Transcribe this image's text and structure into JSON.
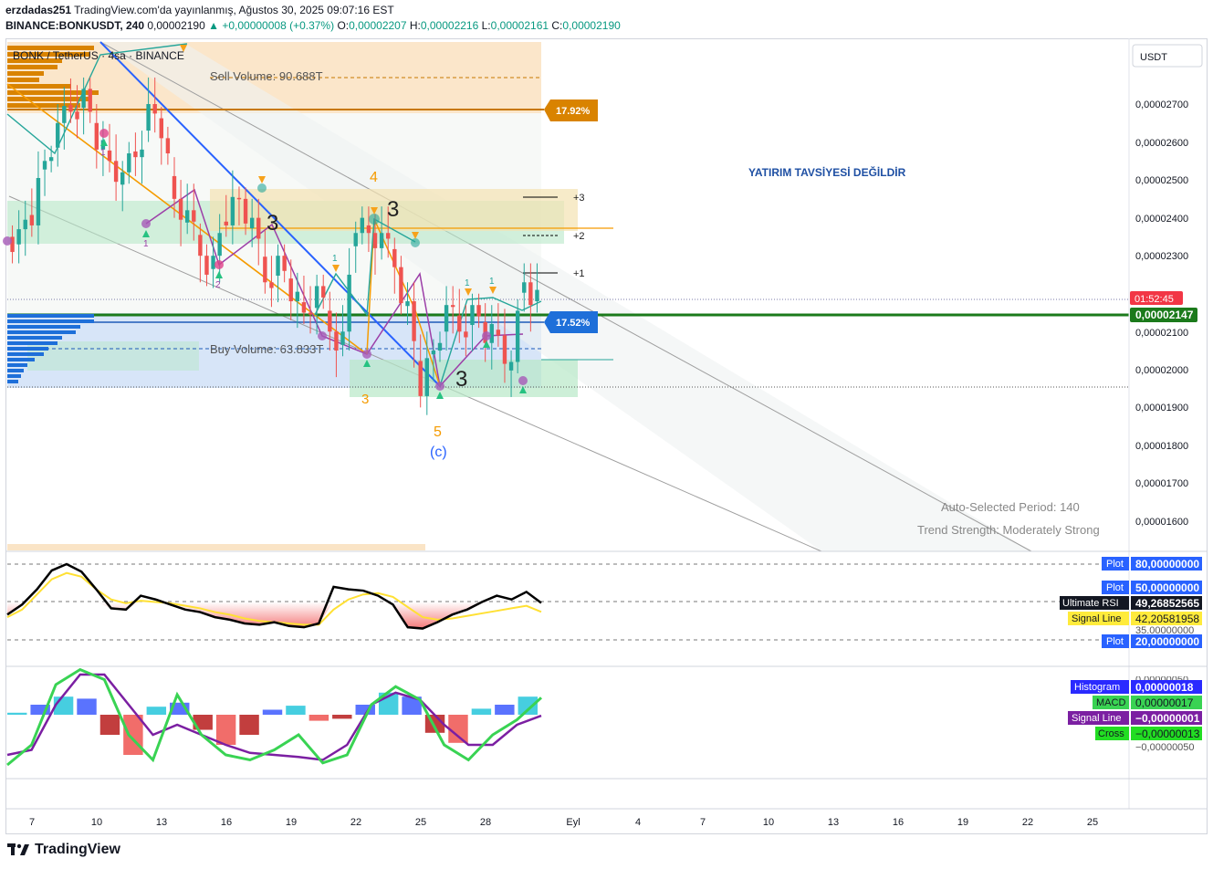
{
  "header": {
    "line1_user": "erzdadas251",
    "line1_rest": " TradingView.com'da yayınlanmış, Ağustos 30, 2025 09:07:16 EST",
    "symbol": "BINANCE:BONKUSDT, 240",
    "last": "0,00002190",
    "change": "▲ +0,00000008 (+0.37%)",
    "o_label": "O:",
    "o": "0,00002207",
    "h_label": "H:",
    "h": "0,00002216",
    "l_label": "L:",
    "l": "0,00002161",
    "c_label": "C:",
    "c": "0,00002190"
  },
  "legend_title": "BONK / TetherUS · 4sa · BINANCE",
  "currency_button": "USDT",
  "annotations": {
    "sell_volume": "Sell Volume: 90.688T",
    "buy_volume": "Buy Volume: 63.833T",
    "disclaimer": "YATIRIM TAVSİYESİ DEĞİLDİR",
    "auto_period": "Auto-Selected Period: 140",
    "trend_strength": "Trend Strength: Moderately Strong",
    "pct_top": "17.92%",
    "pct_mid": "17.52%",
    "wave_4": "4",
    "wave_3a": "3",
    "wave_3b": "3",
    "wave_3c": "3",
    "wave_5": "5",
    "wave_c": "(c)",
    "plus3": "+3",
    "plus2": "+2",
    "plus1": "+1",
    "small_1a": "1",
    "small_1b": "1",
    "small_1c": "1",
    "small_1d": "1",
    "small_1e": "1",
    "small_2": "2",
    "small_3": "3"
  },
  "price_axis": {
    "ticks": [
      "0,00002700",
      "0,00002600",
      "0,00002500",
      "0,00002400",
      "0,00002300",
      "0,00002100",
      "0,00002000",
      "0,00001900",
      "0,00001800",
      "0,00001700",
      "0,00001600"
    ],
    "countdown": "01:52:45",
    "current_price": "0,00002147"
  },
  "rsi_labels": {
    "plot80_name": "Plot",
    "plot80": "80,00000000",
    "plot50_name": "Plot",
    "plot50": "50,00000000",
    "urs_name": "Ultimate RSI",
    "urs": "49,26852565",
    "sig_name": "Signal Line",
    "sig": "42,20581958",
    "partial": "35,00000000",
    "plot20_name": "Plot",
    "plot20": "20,00000000"
  },
  "macd_labels": {
    "top_tick": "0,00000050",
    "hist_name": "Histogram",
    "hist": "0,00000018",
    "macd_name": "MACD",
    "macd": "0,00000017",
    "sig_name": "Signal Line",
    "sig": "−0,00000001",
    "cross_name": "Cross",
    "cross": "−0,00000013",
    "bottom_tick": "−0,00000050"
  },
  "time_axis": [
    "7",
    "10",
    "13",
    "16",
    "19",
    "22",
    "25",
    "28",
    "Eyl",
    "4",
    "7",
    "10",
    "13",
    "16",
    "19",
    "22",
    "25"
  ],
  "footer_brand": "TradingView",
  "colors": {
    "up": "#26a69a",
    "down": "#ef5350",
    "orange": "#f7a21b",
    "blue": "#2962ff",
    "green_line": "#1b7a1b",
    "wave_orange": "#f59b00",
    "sell_zone": "#f9ddb8",
    "buy_zone": "#c9dcf6"
  },
  "chart_data": {
    "type": "candlestick",
    "title": "BONK / TetherUS · 4sa · BINANCE",
    "xlabel": "",
    "ylabel": "",
    "x_tick_labels": [
      "7",
      "10",
      "13",
      "16",
      "19",
      "22",
      "25",
      "28",
      "Eyl",
      "4",
      "7",
      "10",
      "13",
      "16",
      "19",
      "22",
      "25"
    ],
    "ylim": [
      1.55e-05,
      2.8e-05
    ],
    "grid": false,
    "series": [
      {
        "name": "price",
        "values": [
          2.35e-05,
          2.42e-05,
          2.55e-05,
          2.61e-05,
          2.7e-05,
          2.72e-05,
          2.62e-05,
          2.55e-05,
          2.48e-05,
          2.58e-05,
          2.68e-05,
          2.65e-05,
          2.45e-05,
          2.38e-05,
          2.32e-05,
          2.28e-05,
          2.42e-05,
          2.45e-05,
          2.36e-05,
          2.25e-05,
          2.28e-05,
          2.22e-05,
          2.15e-05,
          2.18e-05,
          2.12e-05,
          2.08e-05,
          2.4e-05,
          2.36e-05,
          2.32e-05,
          2.29e-05,
          2.16e-05,
          1.97e-05,
          2.05e-05,
          2.13e-05,
          2.12e-05,
          2.15e-05,
          2.11e-05,
          2.09e-05,
          1.98e-05,
          2.25e-05,
          2.19e-05
        ]
      }
    ],
    "ultimate_rsi": [
      40,
      48,
      60,
      75,
      80,
      74,
      60,
      45,
      44,
      55,
      52,
      48,
      44,
      42,
      38,
      36,
      33,
      32,
      34,
      31,
      30,
      33,
      62,
      60,
      59,
      55,
      48,
      30,
      29,
      34,
      40,
      44,
      50,
      55,
      52,
      58,
      49.27
    ],
    "rsi_signal": [
      38,
      44,
      56,
      68,
      73,
      70,
      60,
      52,
      49,
      51,
      50,
      49,
      47,
      45,
      42,
      40,
      37,
      35,
      34,
      33,
      32,
      32,
      44,
      52,
      56,
      57,
      54,
      46,
      38,
      36,
      37,
      39,
      41,
      43,
      45,
      47,
      42.21
    ],
    "rsi_levels": [
      80,
      50,
      20
    ],
    "macd_histogram": [
      2e-08,
      1e-07,
      1.8e-07,
      1.6e-07,
      -2e-07,
      -4e-07,
      8e-08,
      1.2e-07,
      -1.5e-07,
      -3e-07,
      -2e-07,
      5e-08,
      9e-08,
      -6e-08,
      -4e-08,
      1e-07,
      2.2e-07,
      1.8e-07,
      -1.8e-07,
      -2.8e-07,
      6e-08,
      1e-07,
      1.8e-07
    ],
    "macd": [
      -5e-07,
      -3e-07,
      3e-07,
      4.5e-07,
      3.5e-07,
      -2e-07,
      -4.5e-07,
      2e-07,
      -2e-07,
      -4e-07,
      -4.5e-07,
      -3.5e-07,
      -2e-07,
      -4.8e-07,
      -4e-07,
      1e-07,
      2.8e-07,
      1.5e-07,
      -3e-07,
      -4.5e-07,
      -2e-07,
      -5e-08,
      1.7e-07
    ],
    "macd_signal": [
      -4e-07,
      -3.5e-07,
      1e-07,
      4e-07,
      4e-07,
      1e-07,
      -2e-07,
      -1e-07,
      -2e-07,
      -3e-07,
      -3.8e-07,
      -4e-07,
      -4.2e-07,
      -4.5e-07,
      -3e-07,
      1e-07,
      2.2e-07,
      1.5e-07,
      -1e-07,
      -3e-07,
      -3e-07,
      -1e-07,
      -1e-08
    ]
  }
}
